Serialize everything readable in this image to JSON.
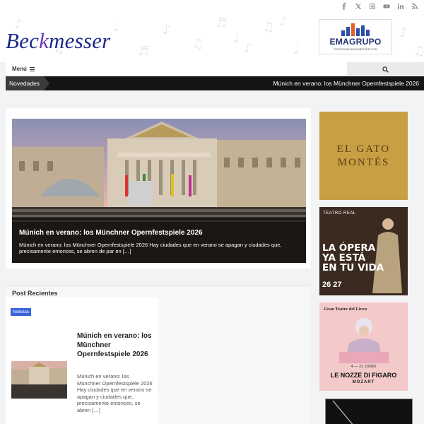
{
  "site": {
    "logo_main": "Bec",
    "logo_accent": "k",
    "logo_rest": "messer"
  },
  "social_icons": [
    "facebook-icon",
    "x-icon",
    "instagram-icon",
    "youtube-icon",
    "linkedin-icon",
    "rss-icon"
  ],
  "header_ad": {
    "brand": "EMAGRUPO",
    "sub": "PATROCINA BECKMESSER.COM"
  },
  "nav": {
    "menu_label": "Menú"
  },
  "ticker": {
    "label": "Novedades",
    "text": "Múnich en verano: los Münchner Opernfestspiele 2026"
  },
  "featured": {
    "title": "Múnich en verano: los Münchner Opernfestspiele 2026",
    "excerpt": "Múnich en verano: los Münchner Opernfestspiele 2026 Hay ciudades que en verano se apagan y ciudades que, precisamente entonces, se abren de par en […]"
  },
  "recent": {
    "section_title": "Post Recientes",
    "category": "Noticias",
    "post_title": "Múnich en verano: los Münchner Opernfestspiele 2026",
    "post_excerpt": "Múnich en verano: los Münchner Opernfestspiele 2026 Hay ciudades que en verano se apagan y ciudades que, precisamente entonces, se abren […]"
  },
  "sidebar_ads": {
    "gato": {
      "line1": "EL GATO",
      "line2": "MONTÉS"
    },
    "real": {
      "org": "TEATRO REAL",
      "line1": "LA ÓPERA",
      "line2": "YA ESTÁ",
      "line3": "EN TU VIDA",
      "season": "26 27"
    },
    "liceu": {
      "org": "Gran Teatre del Liceu",
      "dates": "4 — 21 JUNIO",
      "opera": "LE NOZZE DI FIGARO",
      "composer": "MOZART"
    }
  },
  "colors": {
    "logo": "#1c2a8a",
    "ticker_bg": "#141414",
    "badge": "#3a63d8",
    "gato_bg": "#c8a044",
    "liceu_bg": "#f3c9c9"
  }
}
